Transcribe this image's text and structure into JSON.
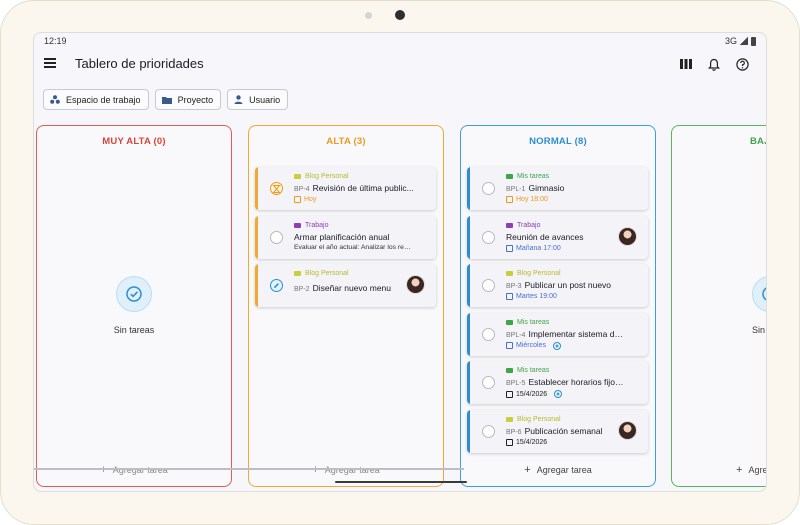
{
  "status_bar": {
    "time": "12:19",
    "network": "3G"
  },
  "app_bar": {
    "title": "Tablero de prioridades"
  },
  "icons": {
    "menu": "menu-icon",
    "columns": "view-columns-icon",
    "bell": "bell-icon",
    "help": "help-icon"
  },
  "filters": [
    {
      "label": "Espacio de trabajo",
      "icon": "workspace-icon"
    },
    {
      "label": "Proyecto",
      "icon": "folder-icon"
    },
    {
      "label": "Usuario",
      "icon": "user-icon"
    }
  ],
  "columns": [
    {
      "title": "MUY ALTA (0)",
      "color": "#d8443c",
      "empty_text": "Sin tareas",
      "add_label": "Agregar tarea",
      "cards": []
    },
    {
      "title": "ALTA (3)",
      "color": "#eb9a1e",
      "add_label": "Agregar tarea",
      "cards": [
        {
          "category": "Blog Personal",
          "category_color": "#c9cf39",
          "code": "BP-4",
          "title": "Revisión de última public...",
          "due": "Hoy",
          "due_color": "#eb9a1e",
          "state": "in-progress"
        },
        {
          "category": "Trabajo",
          "category_color": "#8e3fb3",
          "code": "",
          "title": "Armar planificación anual",
          "subtitle": "Evaluar el año actual: Analizar los resu...",
          "state": "open"
        },
        {
          "category": "Blog Personal",
          "category_color": "#c9cf39",
          "code": "BP-2",
          "title": "Diseñar nuevo menu",
          "state": "editing",
          "has_avatar": true
        }
      ]
    },
    {
      "title": "NORMAL (8)",
      "color": "#2b8fcf",
      "add_label": "Agregar tarea",
      "cards": [
        {
          "category": "Mis tareas",
          "category_color": "#3fa646",
          "code": "BPL-1",
          "title": "Gimnasio",
          "due": "Hoy 18:00",
          "due_color": "#eb9a1e"
        },
        {
          "category": "Trabajo",
          "category_color": "#8e3fb3",
          "code": "",
          "title": "Reunión de avances",
          "due": "Mañana 17:00",
          "due_color": "#4a6fd6",
          "has_avatar": true
        },
        {
          "category": "Blog Personal",
          "category_color": "#c9cf39",
          "code": "BP-3",
          "title": "Publicar un post nuevo",
          "due": "Martes 19:00",
          "due_color": "#4a6fd6"
        },
        {
          "category": "Mis tareas",
          "category_color": "#3fa646",
          "code": "BPL-4",
          "title": "Implementar sistema de...",
          "due": "Miércoles",
          "due_color": "#4a6fd6",
          "recurring": true
        },
        {
          "category": "Mis tareas",
          "category_color": "#3fa646",
          "code": "BPL-5",
          "title": "Establecer horarios fijos...",
          "due": "15/4/2026",
          "due_color": "#222222",
          "recurring": true
        },
        {
          "category": "Blog Personal",
          "category_color": "#c9cf39",
          "code": "BP-6",
          "title": "Publicación semanal",
          "due": "15/4/2026",
          "due_color": "#222222",
          "has_avatar": true
        }
      ]
    },
    {
      "title": "BAJ",
      "color": "#3fa646",
      "empty_text": "Sin t",
      "add_label": "Agre",
      "cards": []
    }
  ]
}
